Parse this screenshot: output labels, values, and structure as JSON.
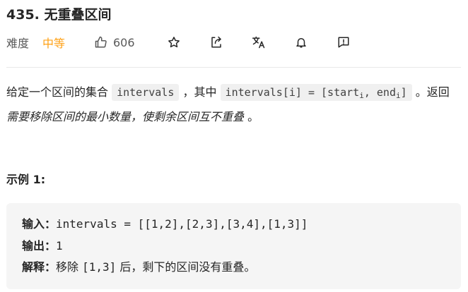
{
  "problem": {
    "title": "435. 无重叠区间",
    "difficulty_label": "难度",
    "difficulty": "中等",
    "likes": "606"
  },
  "toolbar": {
    "icons": [
      "thumbs-up-icon",
      "star-icon",
      "share-icon",
      "translate-icon",
      "bell-icon",
      "feedback-icon"
    ]
  },
  "description": {
    "p1_a": "给定一个区间的集合 ",
    "code1": "intervals",
    "p1_b": " ，其中 ",
    "code2_a": "intervals[i] = [start",
    "code2_sub1": "i",
    "code2_b": ", end",
    "code2_sub2": "i",
    "code2_c": "]",
    "p1_c": " 。返回 ",
    "emph": "需要移除区间的最小数量，使剩余区间互不重叠",
    "p1_d": " 。"
  },
  "example": {
    "title": "示例 1:",
    "input_label": "输入：",
    "input_value": "intervals = [[1,2],[2,3],[3,4],[1,3]]",
    "output_label": "输出：",
    "output_value": "1",
    "explain_label": "解释：",
    "explain_a": "移除 ",
    "explain_code": "[1,3]",
    "explain_b": " 后，剩下的区间没有重叠。"
  },
  "colors": {
    "accent_medium": "#ffa116",
    "text": "#262626",
    "code_bg": "#f0f0f0",
    "example_bg": "#f5f5f5"
  }
}
